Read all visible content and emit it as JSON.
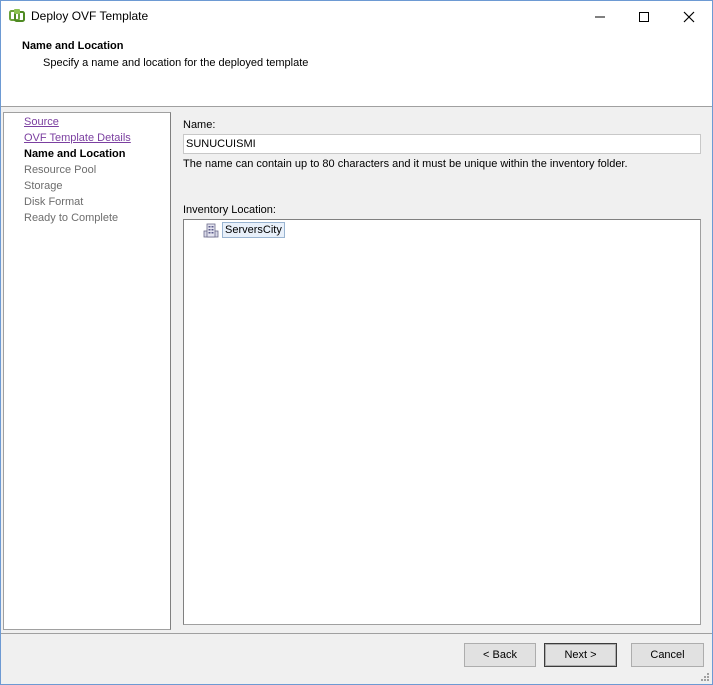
{
  "window": {
    "title": "Deploy OVF Template",
    "controls": {
      "minimize": "minimize",
      "maximize": "maximize",
      "close": "close"
    }
  },
  "header": {
    "title": "Name and Location",
    "subtitle": "Specify a name and location for the deployed template"
  },
  "steps": [
    {
      "label": "Source",
      "state": "link"
    },
    {
      "label": "OVF Template Details",
      "state": "link"
    },
    {
      "label": "Name and Location",
      "state": "current"
    },
    {
      "label": "Resource Pool",
      "state": "disabled"
    },
    {
      "label": "Storage",
      "state": "disabled"
    },
    {
      "label": "Disk Format",
      "state": "disabled"
    },
    {
      "label": "Ready to Complete",
      "state": "disabled"
    }
  ],
  "form": {
    "name_label": "Name:",
    "name_value": "SUNUCUISMI",
    "hint": "The name can contain up to 80 characters and it must be unique within the inventory folder.",
    "inventory_label": "Inventory Location:",
    "tree": [
      {
        "label": "ServersCity",
        "icon": "datacenter-icon",
        "selected": true
      }
    ]
  },
  "buttons": {
    "back": "< Back",
    "next": "Next >",
    "cancel": "Cancel"
  },
  "colors": {
    "link": "#7b3fa0",
    "disabled": "#6d6d6d",
    "border": "#a0a0a0",
    "selection": "#e8f0fa"
  }
}
